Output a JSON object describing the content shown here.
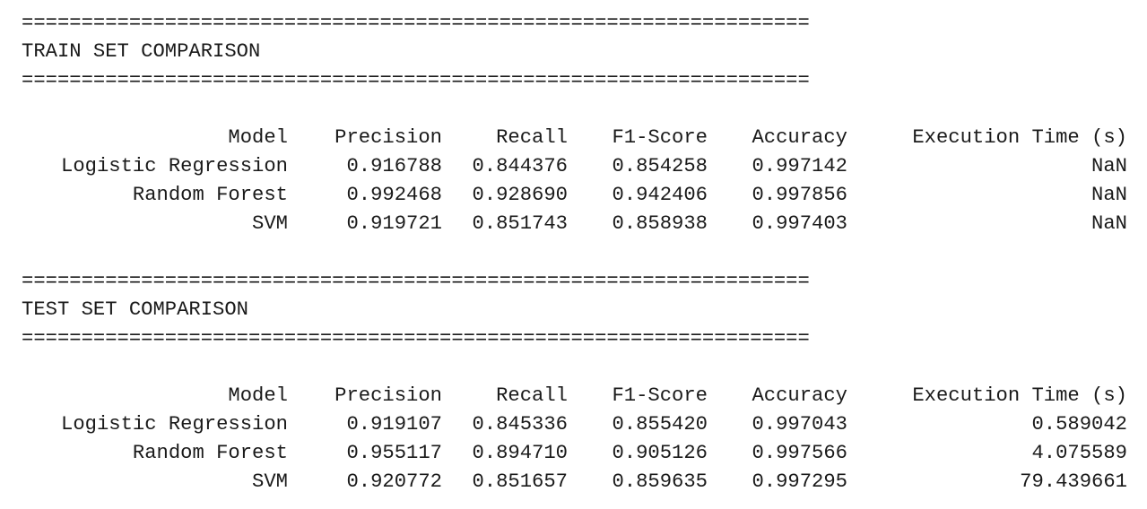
{
  "rule": "==================================================================",
  "sections": [
    {
      "title": "TRAIN SET COMPARISON",
      "headers": [
        "Model",
        "Precision",
        "Recall",
        "F1-Score",
        "Accuracy",
        "Execution Time (s)"
      ],
      "rows": [
        [
          "Logistic Regression",
          "0.916788",
          "0.844376",
          "0.854258",
          "0.997142",
          "NaN"
        ],
        [
          "Random Forest",
          "0.992468",
          "0.928690",
          "0.942406",
          "0.997856",
          "NaN"
        ],
        [
          "SVM",
          "0.919721",
          "0.851743",
          "0.858938",
          "0.997403",
          "NaN"
        ]
      ]
    },
    {
      "title": "TEST SET COMPARISON",
      "headers": [
        "Model",
        "Precision",
        "Recall",
        "F1-Score",
        "Accuracy",
        "Execution Time (s)"
      ],
      "rows": [
        [
          "Logistic Regression",
          "0.919107",
          "0.845336",
          "0.855420",
          "0.997043",
          "0.589042"
        ],
        [
          "Random Forest",
          "0.955117",
          "0.894710",
          "0.905126",
          "0.997566",
          "4.075589"
        ],
        [
          "SVM",
          "0.920772",
          "0.851657",
          "0.859635",
          "0.997295",
          "79.439661"
        ]
      ]
    }
  ]
}
